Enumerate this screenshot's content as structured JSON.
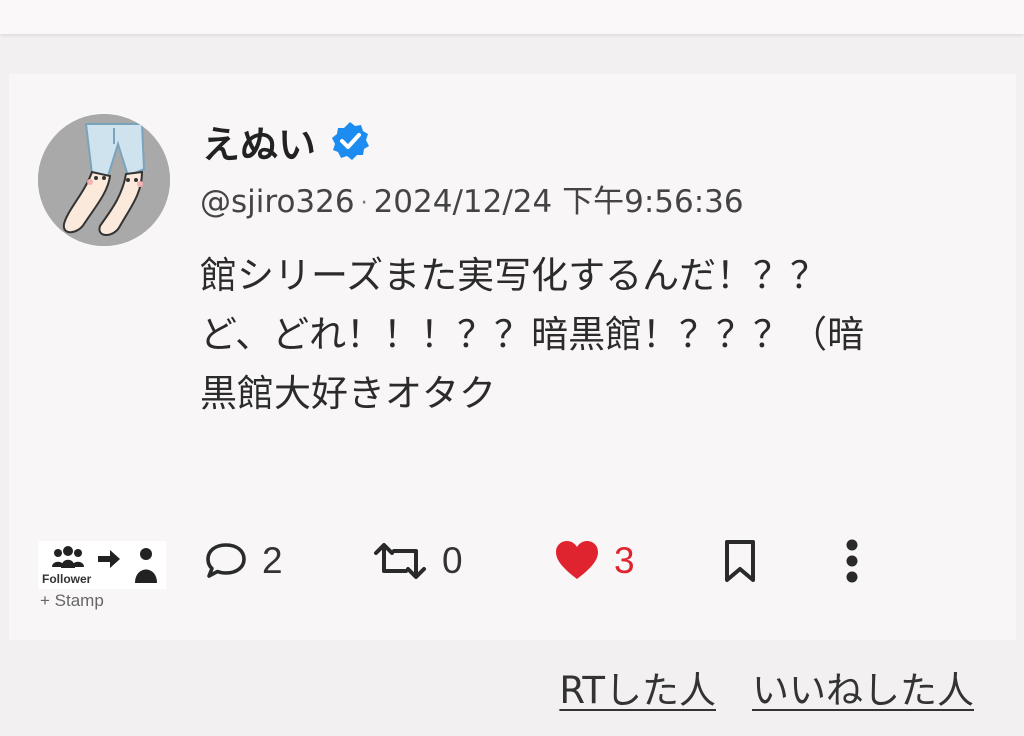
{
  "post": {
    "display_name": "えぬい",
    "handle": "@sjiro326",
    "separator": "·",
    "timestamp": "2024/12/24 下午9:56:36",
    "text_lines": [
      "館シリーズまた実写化するんだ！？？",
      "ど、どれ！！！？？暗黒館！？？？（暗",
      "黒館大好きオタク"
    ]
  },
  "stamp": {
    "follower_label": "Follower",
    "caption": "+ Stamp"
  },
  "actions": {
    "reply_count": "2",
    "retweet_count": "0",
    "like_count": "3"
  },
  "links": {
    "retweeted_by": "RTした人",
    "liked_by": "いいねした人"
  },
  "icons": {
    "verified": "verified-badge-icon",
    "reply": "speech-bubble-icon",
    "retweet": "retweet-icon",
    "like": "heart-icon",
    "bookmark": "bookmark-icon",
    "more": "vertical-ellipsis-icon"
  },
  "colors": {
    "verified": "#1d8cf0",
    "like": "#e0242f",
    "card_bg": "#f8f6f7",
    "page_bg": "#f2f0f1"
  }
}
